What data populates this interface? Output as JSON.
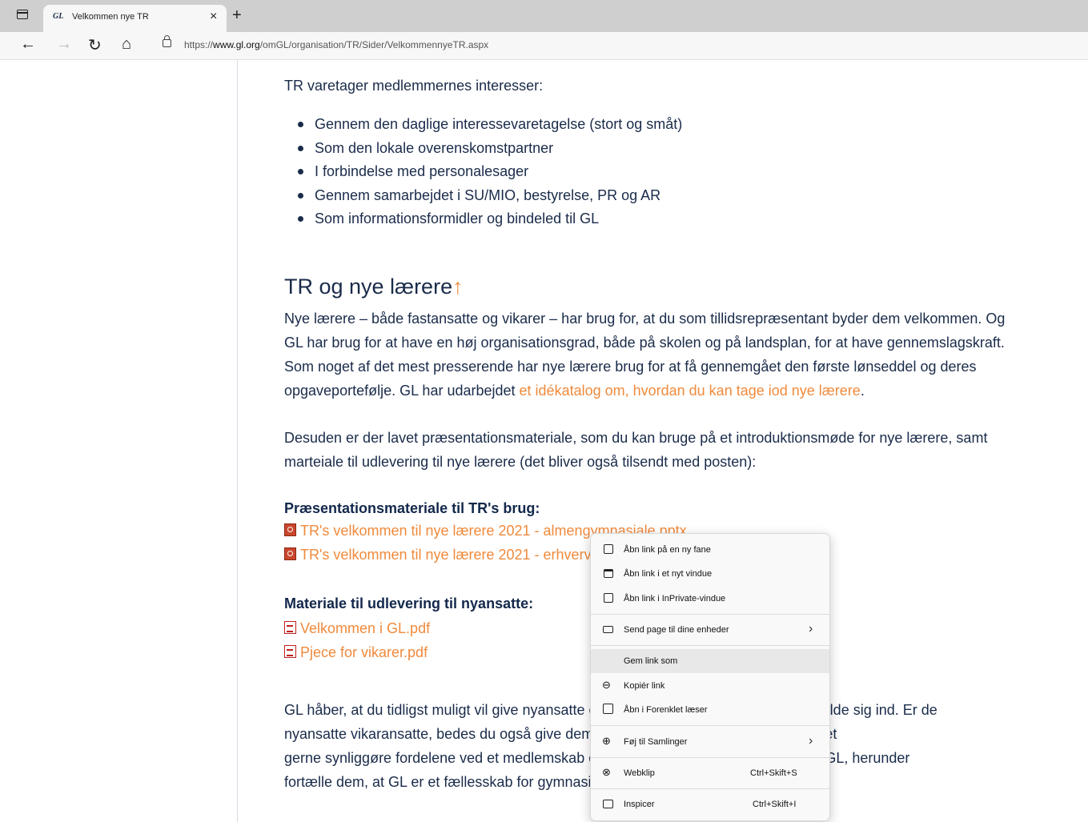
{
  "browser": {
    "tab_title": "Velkommen nye TR",
    "tab_favicon": "GL",
    "url_prefix": "https://",
    "url_domain": "www.gl.org",
    "url_path": "/omGL/organisation/TR/Sider/VelkommennyeTR.aspx",
    "icons": [
      "tab-actions-icon",
      "close-icon",
      "new-tab-icon",
      "back-icon",
      "forward-icon",
      "reload-icon",
      "home-icon",
      "lock-icon"
    ]
  },
  "page": {
    "intro": "TR varetager medlemmernes interesser:",
    "bullets": [
      "Gennem den daglige interessevaretagelse (stort og småt)",
      "Som den lokale overenskomstpartner",
      "I forbindelse med personalesager",
      "Gennem samarbejdet i SU/MIO, bestyrelse, PR og AR",
      "Som informationsformidler og bindeled til GL"
    ],
    "heading": "TR og nye lærere",
    "heading_arrow": "↑",
    "para1_line1": "Nye lærere – både fastansatte og vikarer – har brug for, at du som tillidsrepræsentant byder dem velkommen. Og",
    "para1_line2": "GL har brug for at have en høj organisationsgrad, både på skolen og på landsplan, for at have gennemslagskraft.",
    "para1_line3": "Som noget af det mest presserende har nye lærere brug for at få gennemgået den første lønseddel og deres",
    "para1_line4_start": "opgaveportefølje. GL har udarbejdet ",
    "para1_link": "et idékatalog om, hvordan du kan tage iod nye lærere",
    "para1_end": ".",
    "para2_line1": "Desuden er der lavet præsentationsmateriale, som du kan bruge på et introduktionsmøde for nye lærere, samt",
    "para2_line2": "marteiale til udlevering til nye lærere (det bliver også tilsendt med posten):",
    "section1_heading": "Præsentationsmateriale til TR's brug:",
    "section1_links": [
      "TR's velkommen til nye lærere 2021 - almengymnasiale.pptx",
      "TR's velkommen til nye lærere 2021 - erhvervsgymnasiale.pptx"
    ],
    "section2_heading": "Materiale til udlevering til nyansatte:",
    "section2_links": [
      "Velkommen i GL.pdf",
      "Pjece for vikarer.pdf"
    ],
    "para3_line1": "GL håber, at du tidligst muligt vil give nyansatte en velkomst og opfordre dem til at melde sig ind. Er de",
    "para3_line2": "nyansatte vikaransatte, bedes du også give dem pjecen for vikaransatte. Du må meget",
    "para3_line3": "gerne synliggøre fordelene ved et medlemskab og opfordre dem til at melde sig ind i GL, herunder",
    "para3_line4": "fortælle dem, at GL er et fællesskab for gymnasielærere."
  },
  "context_menu": {
    "items": [
      {
        "label": "Åbn link på en ny fane",
        "icon": "new-tab-icon"
      },
      {
        "label": "Åbn link i et nyt vindue",
        "icon": "new-window-icon"
      },
      {
        "label": "Åbn link i InPrivate-vindue",
        "icon": "inprivate-icon"
      },
      {
        "label": "Send page til dine enheder",
        "icon": "devices-icon",
        "submenu": true
      },
      {
        "label": "Gem link som",
        "icon": "",
        "highlighted": true
      },
      {
        "label": "Kopiér link",
        "icon": "link-icon"
      },
      {
        "label": "Åbn i Forenklet læser",
        "icon": "reader-icon"
      },
      {
        "label": "Føj til Samlinger",
        "icon": "collections-icon",
        "submenu": true
      },
      {
        "label": "Webklip",
        "icon": "webclip-icon",
        "shortcut": "Ctrl+Skift+S"
      },
      {
        "label": "Inspicer",
        "icon": "inspect-icon",
        "shortcut": "Ctrl+Skift+I"
      }
    ]
  }
}
